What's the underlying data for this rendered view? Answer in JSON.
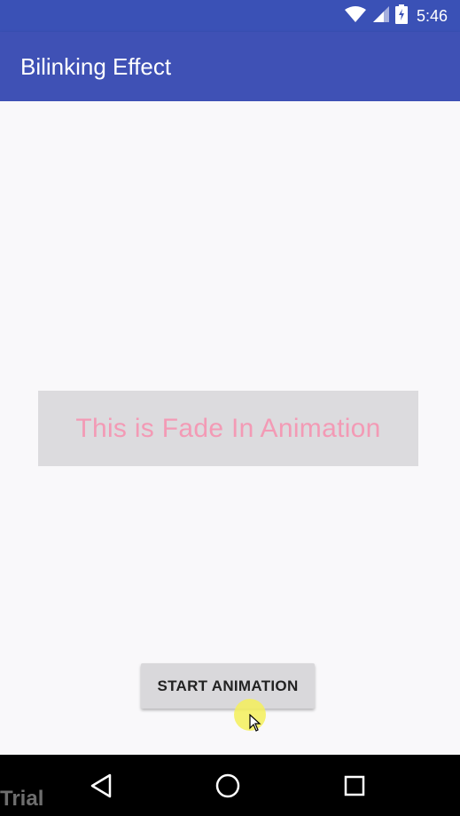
{
  "status_bar": {
    "time": "5:46",
    "icons": [
      "wifi-icon",
      "cell-signal-icon",
      "battery-icon"
    ]
  },
  "app_bar": {
    "title": "Bilinking Effect",
    "color": "#3f51b5"
  },
  "content": {
    "fade_text": "This is Fade In Animation",
    "fade_text_color": "#f39ab5",
    "start_button_label": "START ANIMATION"
  },
  "nav_bar": {
    "icons": [
      "back-icon",
      "home-icon",
      "recents-icon"
    ]
  },
  "watermark": "Trial"
}
